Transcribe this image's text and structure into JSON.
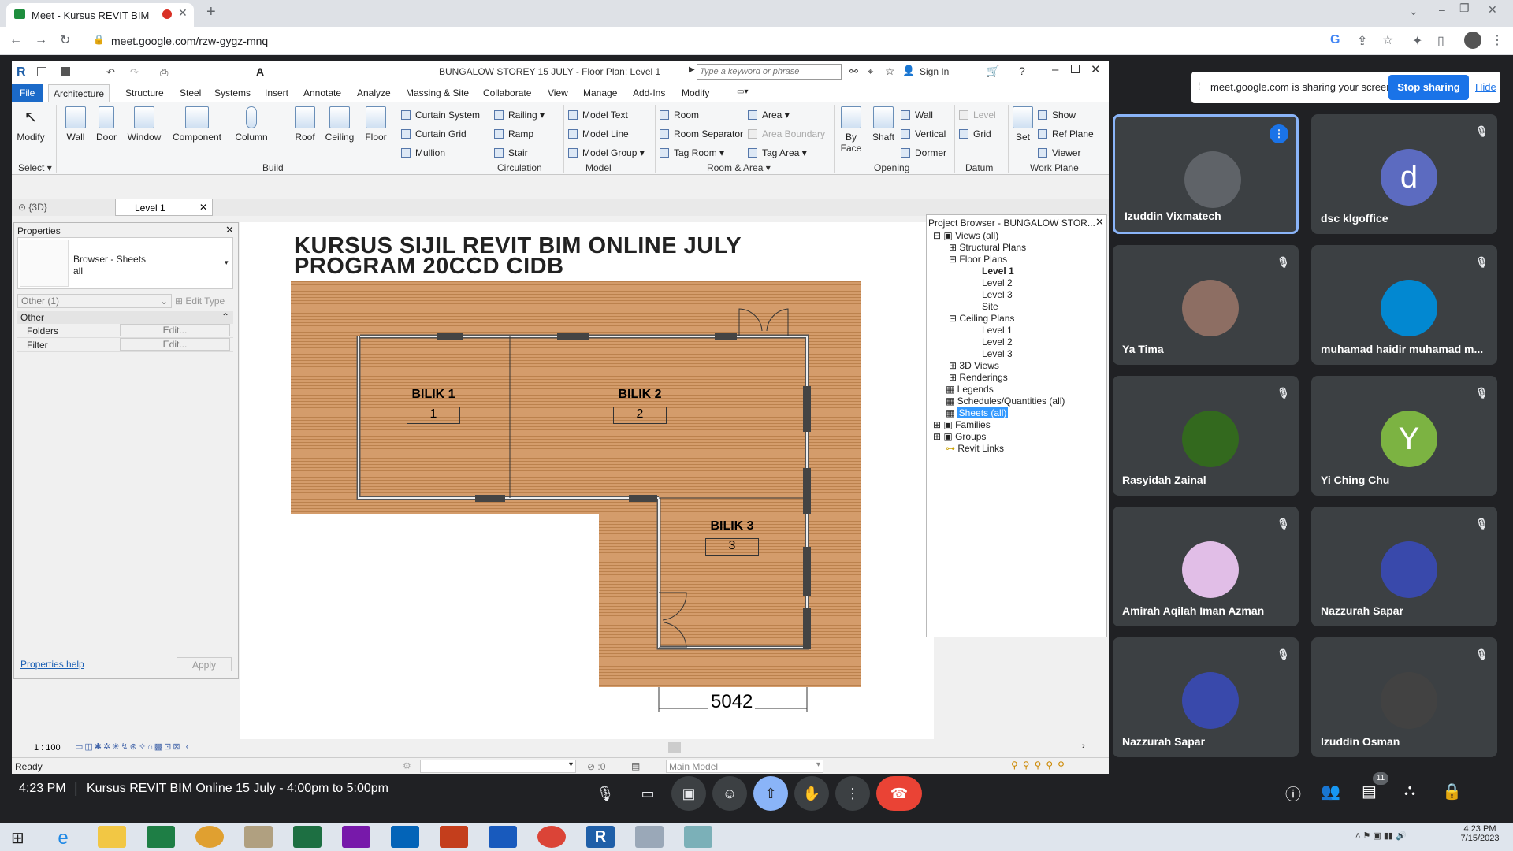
{
  "browser": {
    "tab_title": "Meet - Kursus REVIT BIM On",
    "url": "meet.google.com/rzw-gygz-mnq"
  },
  "revit": {
    "title": "BUNGALOW STOREY 15 JULY - Floor Plan: Level 1",
    "search_placeholder": "Type a keyword or phrase",
    "sign_in": "Sign In",
    "menu": [
      "File",
      "Architecture",
      "Structure",
      "Steel",
      "Systems",
      "Insert",
      "Annotate",
      "Analyze",
      "Massing & Site",
      "Collaborate",
      "View",
      "Manage",
      "Add-Ins",
      "Modify"
    ],
    "ribbon": {
      "big": [
        "Modify",
        "Wall",
        "Door",
        "Window",
        "Component",
        "Column",
        "Roof",
        "Ceiling",
        "Floor",
        "By Face",
        "Shaft",
        "Set"
      ],
      "small": [
        "Curtain System",
        "Curtain Grid",
        "Mullion",
        "Railing",
        "Ramp",
        "Stair",
        "Model Text",
        "Model Line",
        "Model Group",
        "Room",
        "Room Separator",
        "Tag Room",
        "Area",
        "Area Boundary",
        "Tag Area",
        "Wall",
        "Vertical",
        "Dormer",
        "Level",
        "Grid",
        "Show",
        "Ref Plane",
        "Viewer"
      ],
      "panels": [
        "Select",
        "Build",
        "Circulation",
        "Model",
        "Room & Area",
        "Opening",
        "Datum",
        "Work Plane"
      ]
    },
    "view_tabs": [
      "{3D}",
      "Level 1"
    ],
    "properties": {
      "title": "Properties",
      "type_name": "Browser - Sheets",
      "type_sub": "all",
      "filter": "Other (1)",
      "edit_type": "Edit Type",
      "group": "Other",
      "rows": [
        {
          "k": "Folders",
          "v": "Edit..."
        },
        {
          "k": "Filter",
          "v": "Edit..."
        }
      ],
      "help": "Properties help",
      "apply": "Apply"
    },
    "drawing": {
      "title_line1": "KURSUS SIJIL REVIT BIM ONLINE JULY",
      "title_line2": "PROGRAM 20CCD CIDB",
      "rooms": [
        {
          "name": "BILIK 1",
          "num": "1"
        },
        {
          "name": "BILIK 2",
          "num": "2"
        },
        {
          "name": "BILIK 3",
          "num": "3"
        }
      ],
      "dimension": "5042"
    },
    "project_browser": {
      "title": "Project Browser - BUNGALOW STOR...",
      "items": [
        "Views (all)",
        "Structural Plans",
        "Floor Plans",
        "Level 1",
        "Level 2",
        "Level 3",
        "Site",
        "Ceiling Plans",
        "Level 1",
        "Level 2",
        "Level 3",
        "3D Views",
        "Renderings",
        "Legends",
        "Schedules/Quantities (all)",
        "Sheets (all)",
        "Families",
        "Groups",
        "Revit Links"
      ]
    },
    "status": {
      "scale": "1 : 100",
      "ready": "Ready",
      "model": "Main Model",
      "zero": ":0"
    }
  },
  "meet": {
    "share_text": "meet.google.com is sharing your screen.",
    "stop": "Stop sharing",
    "hide": "Hide",
    "participants": [
      {
        "name": "Izuddin Vixmatech",
        "color": "#5f6368"
      },
      {
        "name": "dsc klgoffice",
        "initial": "d",
        "color": "#5c6bc0"
      },
      {
        "name": "Ya Tima",
        "color": "#8d6e63"
      },
      {
        "name": "muhamad haidir muhamad m...",
        "color": "#0288d1"
      },
      {
        "name": "Rasyidah Zainal",
        "color": "#33691e"
      },
      {
        "name": "Yi Ching Chu",
        "initial": "Y",
        "color": "#7cb342"
      },
      {
        "name": "Amirah Aqilah Iman Azman",
        "color": "#e1bee7"
      },
      {
        "name": "Nazzurah Sapar",
        "color": "#3949ab"
      },
      {
        "name": "Nazzurah Sapar",
        "color": "#3949ab"
      },
      {
        "name": "Izuddin Osman",
        "color": "#424242"
      }
    ],
    "time": "4:23 PM",
    "meeting": "Kursus REVIT BIM Online 15 July - 4:00pm to 5:00pm",
    "count": "11"
  },
  "taskbar": {
    "time": "4:23 PM",
    "date": "7/15/2023"
  }
}
